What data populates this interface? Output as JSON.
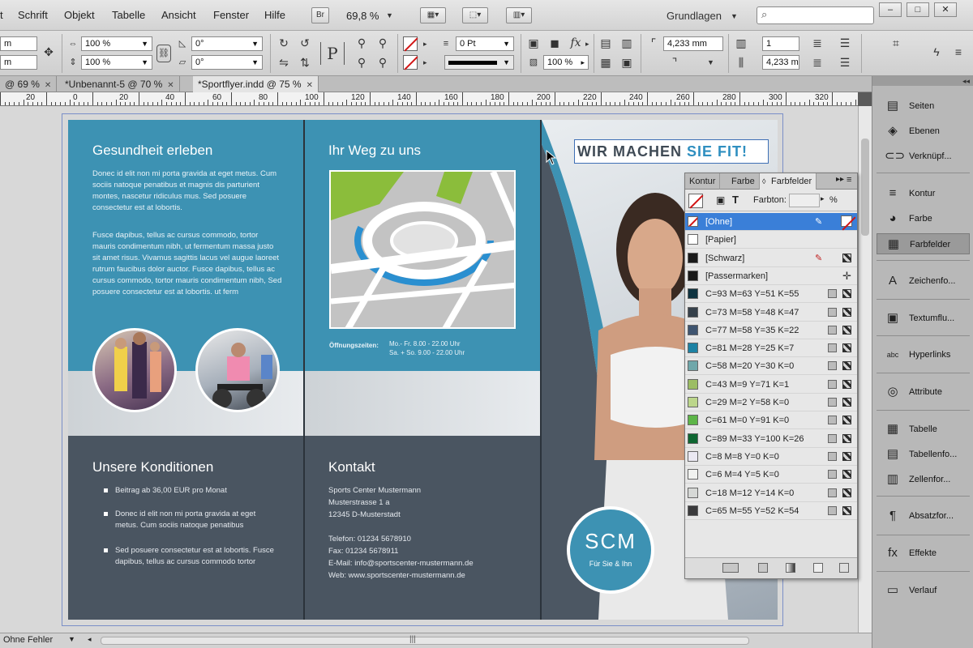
{
  "menu": {
    "items": [
      "t",
      "Schrift",
      "Objekt",
      "Tabelle",
      "Ansicht",
      "Fenster",
      "Hilfe"
    ],
    "br": "Br",
    "zoom": "69,8 %",
    "workspace": "Grundlagen"
  },
  "window": {
    "minimize": "–",
    "maximize": "□",
    "close": "✕"
  },
  "control": {
    "mm_top": "m",
    "mm_bottom": "m",
    "scale_x": "100 %",
    "scale_y": "100 %",
    "rotate": "0°",
    "shear": "0°",
    "stroke_weight": "0 Pt",
    "opacity": "100 %",
    "ref_p": "P",
    "width_mm": "4,233 mm",
    "height_mm": "4,233 m",
    "columns": "1",
    "fx": "fx"
  },
  "tabs": [
    {
      "label": "@ 69 %"
    },
    {
      "label": "*Unbenannt-5 @ 70 %"
    },
    {
      "label": "*Sportflyer.indd @ 75 %"
    }
  ],
  "ruler": {
    "labels": [
      "20",
      "0",
      "20",
      "40",
      "60",
      "80",
      "100",
      "120",
      "140",
      "160",
      "180",
      "200",
      "220",
      "240",
      "260",
      "280",
      "300",
      "320"
    ]
  },
  "doc": {
    "left": {
      "heading": "Gesundheit erleben",
      "p1": "Donec id elit non mi porta gravida at eget metus. Cum sociis natoque penatibus et magnis dis parturient montes, nascetur ridiculus mus. Sed posuere consectetur est at lobortis.",
      "p2": "Fusce dapibus, tellus ac cursus commodo, tortor mauris condimentum nibh, ut fermentum massa justo sit amet risus. Vivamus sagittis lacus vel augue laoreet rutrum faucibus dolor auctor. Fusce dapibus, tellus ac cursus commodo, tortor mauris condimentum nibh, Sed posuere consectetur est at lobortis. ut ferm",
      "conditions_heading": "Unsere Konditionen",
      "bullets": [
        "Beitrag ab 36,00 EUR pro Monat",
        "Donec id elit non mi porta gravida at eget metus. Cum sociis natoque penatibus",
        "Sed posuere consectetur est at lobortis. Fusce dapibus, tellus ac cursus commodo tortor"
      ]
    },
    "middle": {
      "heading": "Ihr Weg zu uns",
      "hours_label": "Öffnungszeiten:",
      "hours_1": "Mo.- Fr. 8.00 - 22.00 Uhr",
      "hours_2": "Sa. + So. 9.00 - 22.00 Uhr",
      "contact_heading": "Kontakt",
      "address": [
        "Sports Center Mustermann",
        "Musterstrasse 1 a",
        "12345 D-Musterstadt"
      ],
      "contact": [
        "Telefon: 01234 5678910",
        "Fax: 01234 5678911",
        "E-Mail: info@sportscenter-mustermann.de",
        "Web: www.sportscenter-mustermann.de"
      ]
    },
    "right": {
      "headline_a": "WIR MACHEN ",
      "headline_b": "SIE FIT!",
      "logo": "SCM",
      "logo_sub": "Für Sie & Ihn"
    }
  },
  "swatches": {
    "tabs": [
      "Kontur",
      "Farbe",
      "Farbfelder"
    ],
    "tint_label": "Farbton:",
    "tint_unit": "%",
    "items": [
      {
        "name": "[Ohne]",
        "color": "none",
        "selected": true
      },
      {
        "name": "[Papier]",
        "color": "#ffffff"
      },
      {
        "name": "[Schwarz]",
        "color": "#1a1a1a"
      },
      {
        "name": "[Passermarken]",
        "color": "#1a1a1a"
      },
      {
        "name": "C=93 M=63 Y=51 K=55",
        "color": "#0e3340"
      },
      {
        "name": "C=73 M=58 Y=48 K=47",
        "color": "#36414b"
      },
      {
        "name": "C=77 M=58 Y=35 K=22",
        "color": "#3f5570"
      },
      {
        "name": "C=81 M=28 Y=25 K=7",
        "color": "#1d82a4"
      },
      {
        "name": "C=58 M=20 Y=30 K=0",
        "color": "#6fa7aa"
      },
      {
        "name": "C=43 M=9 Y=71 K=1",
        "color": "#9cbd64"
      },
      {
        "name": "C=29 M=2 Y=58 K=0",
        "color": "#bcd68b"
      },
      {
        "name": "C=61 M=0 Y=91 K=0",
        "color": "#5db548"
      },
      {
        "name": "C=89 M=33 Y=100 K=26",
        "color": "#0e6631"
      },
      {
        "name": "C=8 M=8 Y=0 K=0",
        "color": "#ebe9f3"
      },
      {
        "name": "C=6 M=4 Y=5 K=0",
        "color": "#f1f2f0"
      },
      {
        "name": "C=18 M=12 Y=14 K=0",
        "color": "#d6d8d6"
      },
      {
        "name": "C=65 M=55 Y=52 K=54",
        "color": "#3a3a3c"
      }
    ]
  },
  "dock": {
    "items": [
      {
        "label": "Seiten",
        "icon": "pages-icon",
        "glyph": "▤"
      },
      {
        "label": "Ebenen",
        "icon": "layers-icon",
        "glyph": "◈"
      },
      {
        "label": "Verknüpf...",
        "icon": "links-icon",
        "glyph": "⊂⊃"
      },
      {
        "label": "Kontur",
        "icon": "stroke-icon",
        "glyph": "≡"
      },
      {
        "label": "Farbe",
        "icon": "color-icon",
        "glyph": "◕"
      },
      {
        "label": "Farbfelder",
        "icon": "swatches-icon",
        "glyph": "▦"
      },
      {
        "label": "Zeichenfo...",
        "icon": "character-styles-icon",
        "glyph": "A"
      },
      {
        "label": "Textumflu...",
        "icon": "text-wrap-icon",
        "glyph": "▣"
      },
      {
        "label": "Hyperlinks",
        "icon": "hyperlinks-icon",
        "glyph": "abc"
      },
      {
        "label": "Attribute",
        "icon": "attributes-icon",
        "glyph": "◎"
      },
      {
        "label": "Tabelle",
        "icon": "table-icon",
        "glyph": "▦"
      },
      {
        "label": "Tabellenfo...",
        "icon": "table-styles-icon",
        "glyph": "▤"
      },
      {
        "label": "Zellenfor...",
        "icon": "cell-styles-icon",
        "glyph": "▥"
      },
      {
        "label": "Absatzfor...",
        "icon": "paragraph-styles-icon",
        "glyph": "¶"
      },
      {
        "label": "Effekte",
        "icon": "effects-icon",
        "glyph": "fx"
      },
      {
        "label": "Verlauf",
        "icon": "gradient-icon",
        "glyph": "▭"
      }
    ]
  },
  "status": {
    "preflight": "Ohne Fehler"
  }
}
